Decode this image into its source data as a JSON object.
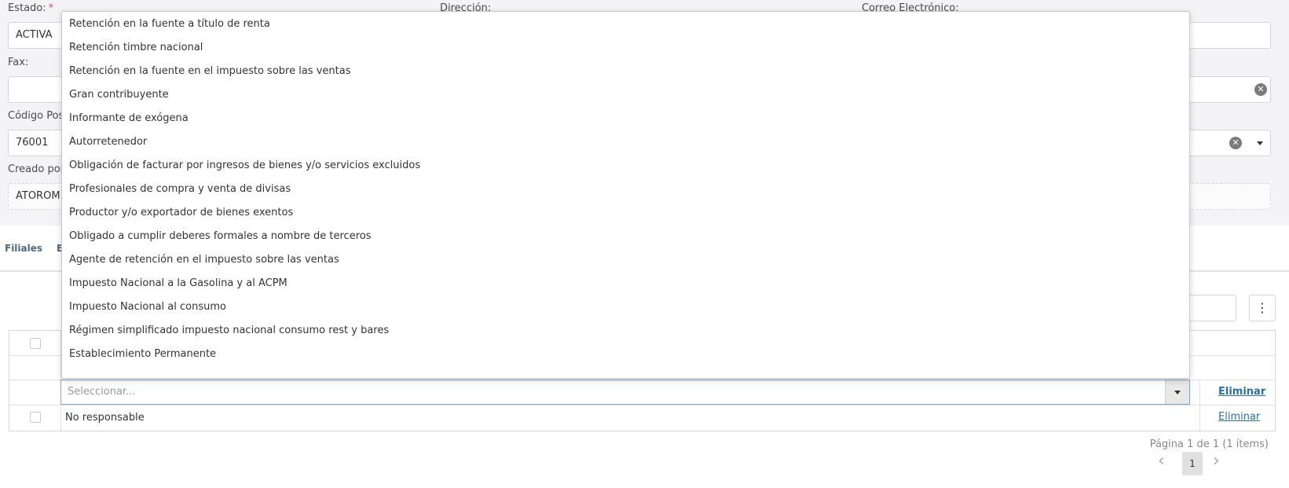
{
  "form": {
    "estado_label": "Estado:",
    "required_mark": "*",
    "estado_value": "ACTIVA",
    "direccion_label": "Dirección:",
    "correo_label": "Correo Electrónico:",
    "fax_label": "Fax:",
    "codigo_postal_label": "Código Post",
    "codigo_postal_value": "76001",
    "creado_por_label": "Creado por:",
    "creado_por_value": "ATOROM"
  },
  "icons": {
    "clear": "clear-icon",
    "dropdown": "chevron-down-icon",
    "menu": "more-vertical-icon",
    "prev": "chevron-left-icon",
    "next": "chevron-right-icon"
  },
  "tabs": [
    {
      "label": "Filiales"
    },
    {
      "label": "E"
    }
  ],
  "grid": {
    "editor_placeholder": "Seleccionar...",
    "rows": [
      {
        "value": "No responsable",
        "action": "Eliminar"
      }
    ],
    "editor_action": "Eliminar",
    "menu_glyph": "⋮"
  },
  "pager": {
    "info": "Página 1 de 1 (1 ítems)",
    "current_page": "1"
  },
  "dropdown": {
    "options": [
      "Retención en la fuente a título de renta",
      "Retención timbre nacional",
      "Retención en la fuente en el impuesto sobre las ventas",
      "Gran contribuyente",
      "Informante de exógena",
      "Autorretenedor",
      "Obligación de facturar por ingresos de bienes y/o servicios excluidos",
      "Profesionales de compra y venta de divisas",
      "Productor y/o exportador de bienes exentos",
      "Obligado a cumplir deberes formales a nombre de terceros",
      "Agente de retención en el impuesto sobre las ventas",
      "Impuesto Nacional a la Gasolina y al ACPM",
      "Impuesto Nacional al consumo",
      "Régimen simplificado impuesto nacional consumo rest y bares",
      "Establecimiento Permanente"
    ]
  },
  "colors": {
    "link": "#2e6da4",
    "tab_text": "#4d6a85",
    "required": "#d9534f",
    "editor_border": "#7fa7c9"
  }
}
